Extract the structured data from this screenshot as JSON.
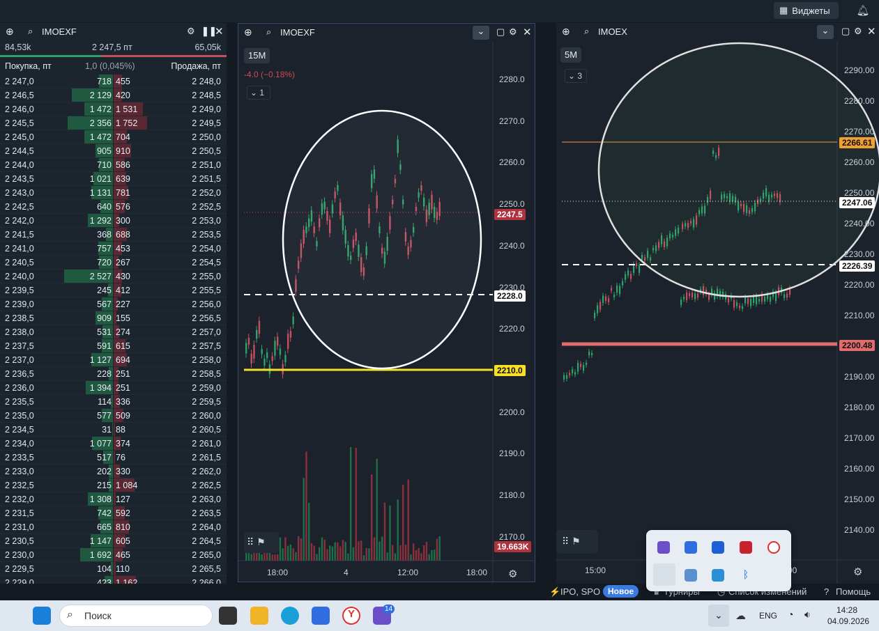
{
  "topbar": {
    "widgets_label": "Виджеты"
  },
  "orderbook": {
    "ticker": "IMOEXF",
    "sum_buy": "84,53k",
    "mid_price": "2 247,5 пт",
    "sum_sell": "65,05k",
    "col_buy": "Покупка, пт",
    "spread": "1,0 (0,045%)",
    "col_sell": "Продажа, пт",
    "rows": [
      {
        "bid": "2 247,0",
        "bvol": "718",
        "avol": "455",
        "ask": "2 248,0"
      },
      {
        "bid": "2 246,5",
        "bvol": "2 129",
        "avol": "420",
        "ask": "2 248,5"
      },
      {
        "bid": "2 246,0",
        "bvol": "1 472",
        "avol": "1 531",
        "ask": "2 249,0"
      },
      {
        "bid": "2 245,5",
        "bvol": "2 356",
        "avol": "1 752",
        "ask": "2 249,5"
      },
      {
        "bid": "2 245,0",
        "bvol": "1 472",
        "avol": "704",
        "ask": "2 250,0"
      },
      {
        "bid": "2 244,5",
        "bvol": "905",
        "avol": "910",
        "ask": "2 250,5"
      },
      {
        "bid": "2 244,0",
        "bvol": "710",
        "avol": "586",
        "ask": "2 251,0"
      },
      {
        "bid": "2 243,5",
        "bvol": "1 021",
        "avol": "639",
        "ask": "2 251,5"
      },
      {
        "bid": "2 243,0",
        "bvol": "1 131",
        "avol": "781",
        "ask": "2 252,0"
      },
      {
        "bid": "2 242,5",
        "bvol": "640",
        "avol": "576",
        "ask": "2 252,5"
      },
      {
        "bid": "2 242,0",
        "bvol": "1 292",
        "avol": "300",
        "ask": "2 253,0"
      },
      {
        "bid": "2 241,5",
        "bvol": "368",
        "avol": "688",
        "ask": "2 253,5"
      },
      {
        "bid": "2 241,0",
        "bvol": "757",
        "avol": "453",
        "ask": "2 254,0"
      },
      {
        "bid": "2 240,5",
        "bvol": "720",
        "avol": "267",
        "ask": "2 254,5"
      },
      {
        "bid": "2 240,0",
        "bvol": "2 527",
        "avol": "430",
        "ask": "2 255,0"
      },
      {
        "bid": "2 239,5",
        "bvol": "245",
        "avol": "412",
        "ask": "2 255,5"
      },
      {
        "bid": "2 239,0",
        "bvol": "567",
        "avol": "227",
        "ask": "2 256,0"
      },
      {
        "bid": "2 238,5",
        "bvol": "909",
        "avol": "155",
        "ask": "2 256,5"
      },
      {
        "bid": "2 238,0",
        "bvol": "531",
        "avol": "274",
        "ask": "2 257,0"
      },
      {
        "bid": "2 237,5",
        "bvol": "591",
        "avol": "615",
        "ask": "2 257,5"
      },
      {
        "bid": "2 237,0",
        "bvol": "1 127",
        "avol": "694",
        "ask": "2 258,0"
      },
      {
        "bid": "2 236,5",
        "bvol": "228",
        "avol": "251",
        "ask": "2 258,5"
      },
      {
        "bid": "2 236,0",
        "bvol": "1 394",
        "avol": "251",
        "ask": "2 259,0"
      },
      {
        "bid": "2 235,5",
        "bvol": "114",
        "avol": "336",
        "ask": "2 259,5"
      },
      {
        "bid": "2 235,0",
        "bvol": "577",
        "avol": "509",
        "ask": "2 260,0"
      },
      {
        "bid": "2 234,5",
        "bvol": "31",
        "avol": "88",
        "ask": "2 260,5"
      },
      {
        "bid": "2 234,0",
        "bvol": "1 077",
        "avol": "374",
        "ask": "2 261,0"
      },
      {
        "bid": "2 233,5",
        "bvol": "517",
        "avol": "76",
        "ask": "2 261,5"
      },
      {
        "bid": "2 233,0",
        "bvol": "202",
        "avol": "330",
        "ask": "2 262,0"
      },
      {
        "bid": "2 232,5",
        "bvol": "215",
        "avol": "1 084",
        "ask": "2 262,5"
      },
      {
        "bid": "2 232,0",
        "bvol": "1 308",
        "avol": "127",
        "ask": "2 263,0"
      },
      {
        "bid": "2 231,5",
        "bvol": "742",
        "avol": "592",
        "ask": "2 263,5"
      },
      {
        "bid": "2 231,0",
        "bvol": "665",
        "avol": "810",
        "ask": "2 264,0"
      },
      {
        "bid": "2 230,5",
        "bvol": "1 147",
        "avol": "605",
        "ask": "2 264,5"
      },
      {
        "bid": "2 230,0",
        "bvol": "1 692",
        "avol": "465",
        "ask": "2 265,0"
      },
      {
        "bid": "2 229,5",
        "bvol": "104",
        "avol": "110",
        "ask": "2 265,5"
      },
      {
        "bid": "2 229,0",
        "bvol": "423",
        "avol": "1 162",
        "ask": "2 266,0"
      }
    ]
  },
  "chart1": {
    "ticker": "IMOEXF",
    "timeframe": "15M",
    "change": "-4.0 (−0.18%)",
    "indicator_count": "1",
    "price_axis": [
      "2280.0",
      "2270.0",
      "2260.0",
      "2250.0",
      "2240.0",
      "2230.0",
      "2220.0",
      "2210.0",
      "2200.0",
      "2190.0",
      "2180.0",
      "2170.0"
    ],
    "time_axis": [
      "18:00",
      "4",
      "12:00",
      "18:00"
    ],
    "last_price_tag": "2247.5",
    "level_dashed_tag": "2228.0",
    "level_yellow_tag": "2210.0",
    "volume_tag": "19.663K"
  },
  "chart2": {
    "ticker": "IMOEX",
    "timeframe": "5M",
    "indicator_count": "3",
    "price_axis": [
      "2290.00",
      "2280.00",
      "2270.00",
      "2260.00",
      "2250.00",
      "2240.00",
      "2230.00",
      "2220.00",
      "2210.00",
      "2200.00",
      "2190.00",
      "2180.00",
      "2170.00",
      "2160.00",
      "2150.00",
      "2140.00"
    ],
    "time_axis": [
      "15:00",
      "00"
    ],
    "level_orange_tag": "2266.61",
    "last_price_tag": "2247.06",
    "level_dashed_tag": "2226.39",
    "level_red_tag": "2200.48"
  },
  "statusbar": {
    "ipo": "IPO, SPO",
    "new_badge": "Новое",
    "tournaments": "Турниры",
    "changelog": "Список изменений",
    "help": "Помощь"
  },
  "taskbar": {
    "search_placeholder": "Поиск",
    "lang": "ENG",
    "time": "14:28",
    "date": "04.09.2026",
    "notif_badge": "14"
  }
}
